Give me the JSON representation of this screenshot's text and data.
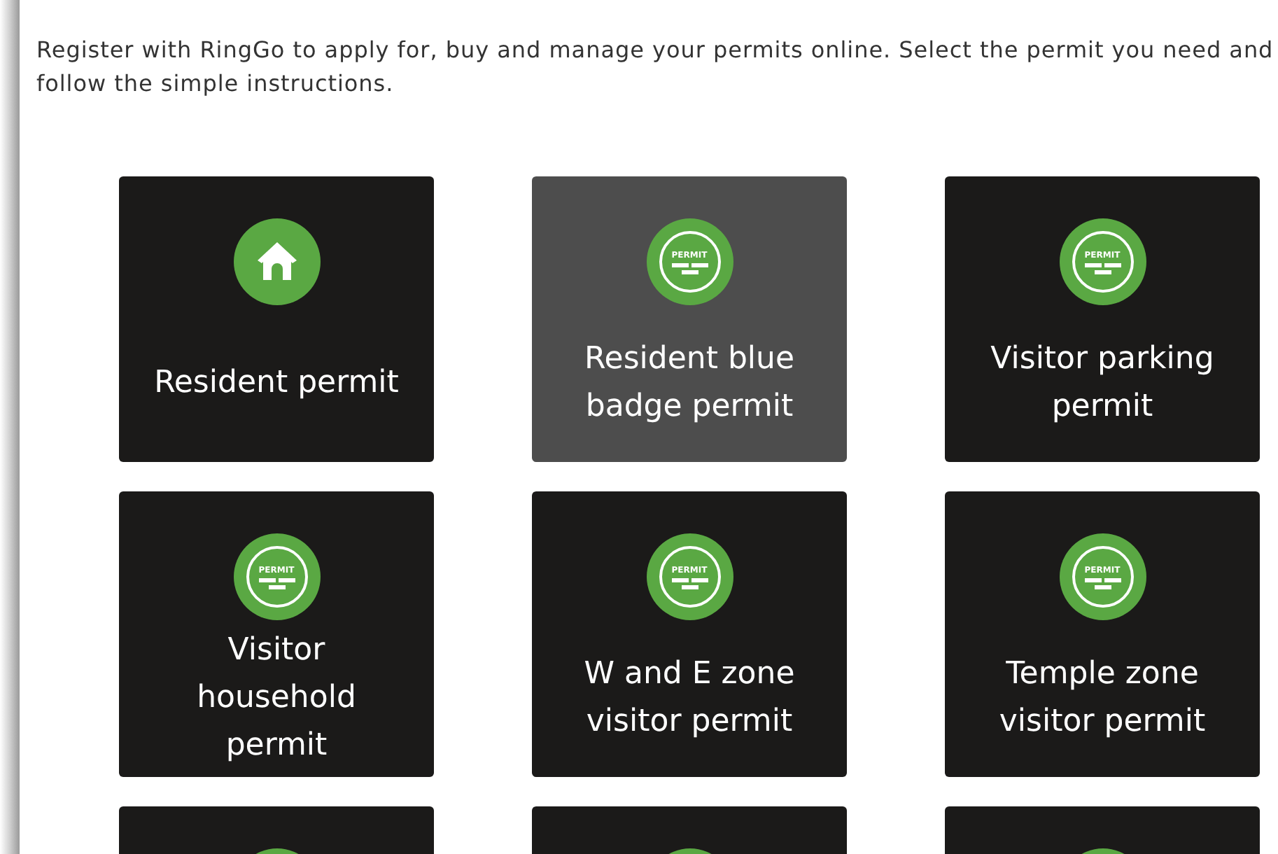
{
  "intro": "Register with RingGo to apply for, buy and manage your permits online. Select the permit you need and follow the simple instructions.",
  "tiles": [
    {
      "label": "Resident permit",
      "kind": "house",
      "selected": false
    },
    {
      "label": "Resident blue badge permit",
      "kind": "permit",
      "icon_text": "PERMIT",
      "selected": true
    },
    {
      "label": "Visitor parking permit",
      "kind": "permit",
      "icon_text": "PERMIT",
      "selected": false
    },
    {
      "label": "Visitor household permit",
      "kind": "permit",
      "icon_text": "PERMIT",
      "selected": false
    },
    {
      "label": "W and E zone visitor permit",
      "kind": "permit",
      "icon_text": "PERMIT",
      "selected": false
    },
    {
      "label": "Temple zone visitor permit",
      "kind": "permit",
      "icon_text": "PERMIT",
      "selected": false
    },
    {
      "kind": "blank",
      "selected": false
    },
    {
      "kind": "blank",
      "selected": false
    },
    {
      "kind": "blank",
      "selected": false
    }
  ]
}
